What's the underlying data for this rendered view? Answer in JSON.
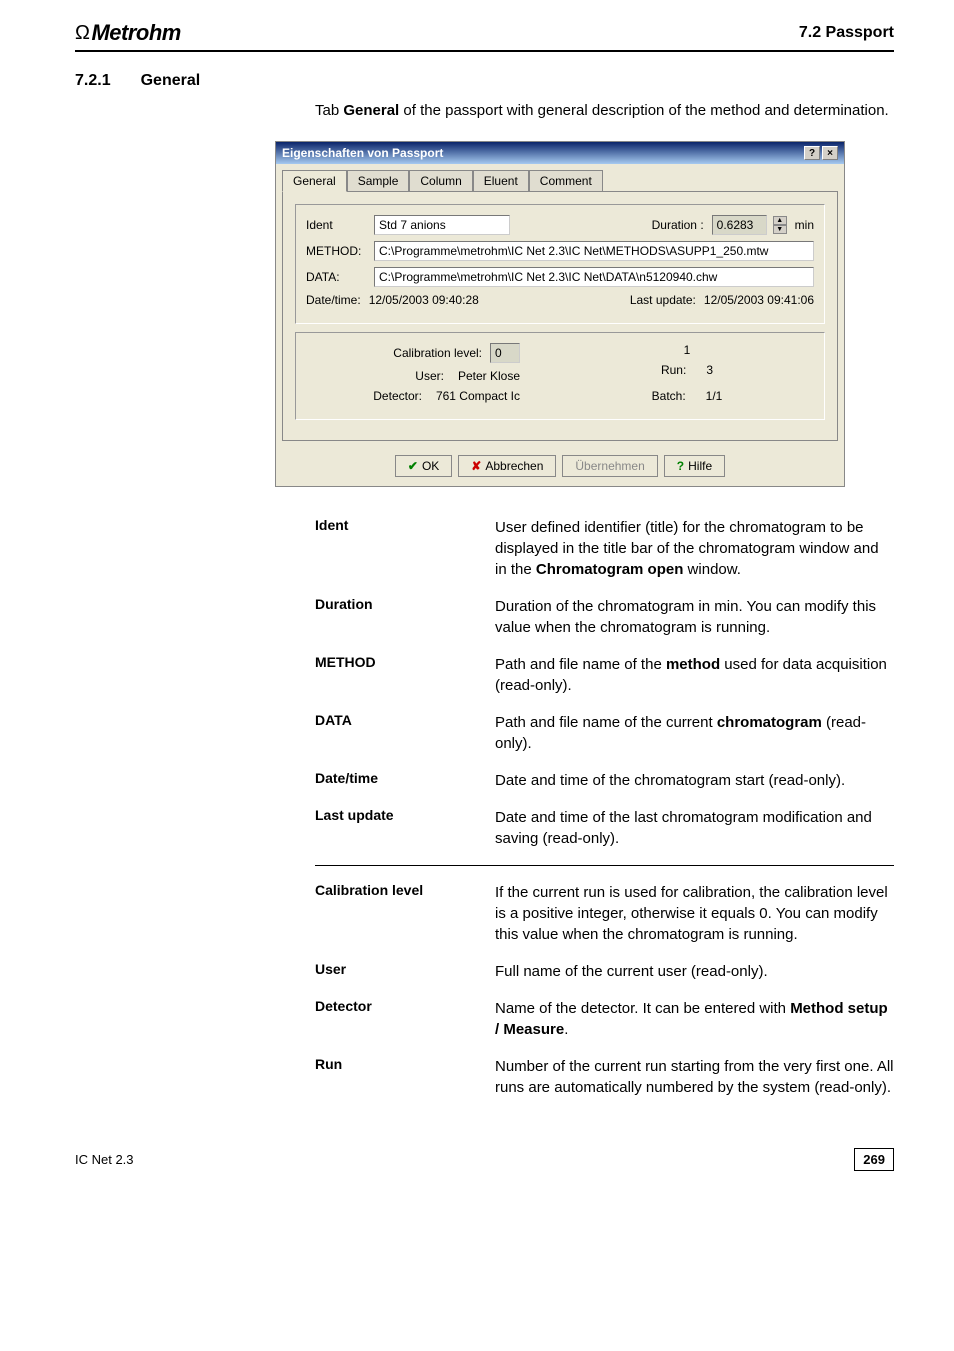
{
  "header": {
    "logo": "Metrohm",
    "right": "7.2  Passport"
  },
  "section": {
    "num": "7.2.1",
    "title": "General"
  },
  "intro": {
    "p1": "Tab ",
    "p2": "General",
    "p3": " of the passport with general description of the method and determination."
  },
  "dialog": {
    "title": "Eigenschaften von Passport",
    "tabs": [
      "General",
      "Sample",
      "Column",
      "Eluent",
      "Comment"
    ],
    "ident_label": "Ident",
    "ident_value": "Std 7 anions",
    "duration_label": "Duration :",
    "duration_value": "0.6283",
    "duration_unit": "min",
    "method_label": "METHOD:",
    "method_value": "C:\\Programme\\metrohm\\IC Net 2.3\\IC Net\\METHODS\\ASUPP1_250.mtw",
    "data_label": "DATA:",
    "data_value": "C:\\Programme\\metrohm\\IC Net 2.3\\IC Net\\DATA\\n5120940.chw",
    "datetime_label": "Date/time:",
    "datetime_value": "12/05/2003 09:40:28",
    "lastupdate_label": "Last update:",
    "lastupdate_value": "12/05/2003 09:41:06",
    "calib_label": "Calibration level:",
    "calib_value": "0",
    "calib_right": "1",
    "user_label": "User:",
    "user_value": "Peter Klose",
    "run_label": "Run:",
    "run_value": "3",
    "detector_label": "Detector:",
    "detector_value": "761 Compact Ic",
    "batch_label": "Batch:",
    "batch_value": "1/1",
    "btn_ok": "OK",
    "btn_cancel": "Abbrechen",
    "btn_apply": "Übernehmen",
    "btn_help": "Hilfe"
  },
  "defs": [
    {
      "term": "Ident",
      "desc_parts": [
        "User defined identifier (title) for the chromatogram to be displayed in the title bar of the chromatogram window and in the ",
        "Chromatogram open",
        " window."
      ]
    },
    {
      "term": "Duration",
      "desc_parts": [
        "Duration of the chromatogram in min. You can modify this value when the chromatogram is running."
      ]
    },
    {
      "term": "METHOD",
      "desc_parts": [
        "Path and file name of the ",
        "method",
        " used for data acquisition (read-only)."
      ]
    },
    {
      "term": "DATA",
      "desc_parts": [
        "Path and file name of the current ",
        "chromatogram",
        " (read-only)."
      ]
    },
    {
      "term": "Date/time",
      "desc_parts": [
        "Date and time of the chromatogram start (read-only)."
      ]
    },
    {
      "term": "Last update",
      "desc_parts": [
        "Date and time of the last chromatogram modification and saving (read-only)."
      ]
    },
    {
      "term": "Calibration level",
      "desc_parts": [
        "If the current run is used for calibration, the calibration level is a positive integer, otherwise it equals 0. You can modify this value when the chromatogram is running."
      ]
    },
    {
      "term": "User",
      "desc_parts": [
        "Full name of the current user (read-only)."
      ]
    },
    {
      "term": "Detector",
      "desc_parts": [
        "Name of the detector. It can be entered with ",
        "Method setup / Measure",
        "."
      ]
    },
    {
      "term": "Run",
      "desc_parts": [
        "Number of the current run starting from the very first one. All runs are automatically numbered by the system (read-only)."
      ]
    }
  ],
  "footer": {
    "left": "IC Net 2.3",
    "page": "269"
  }
}
